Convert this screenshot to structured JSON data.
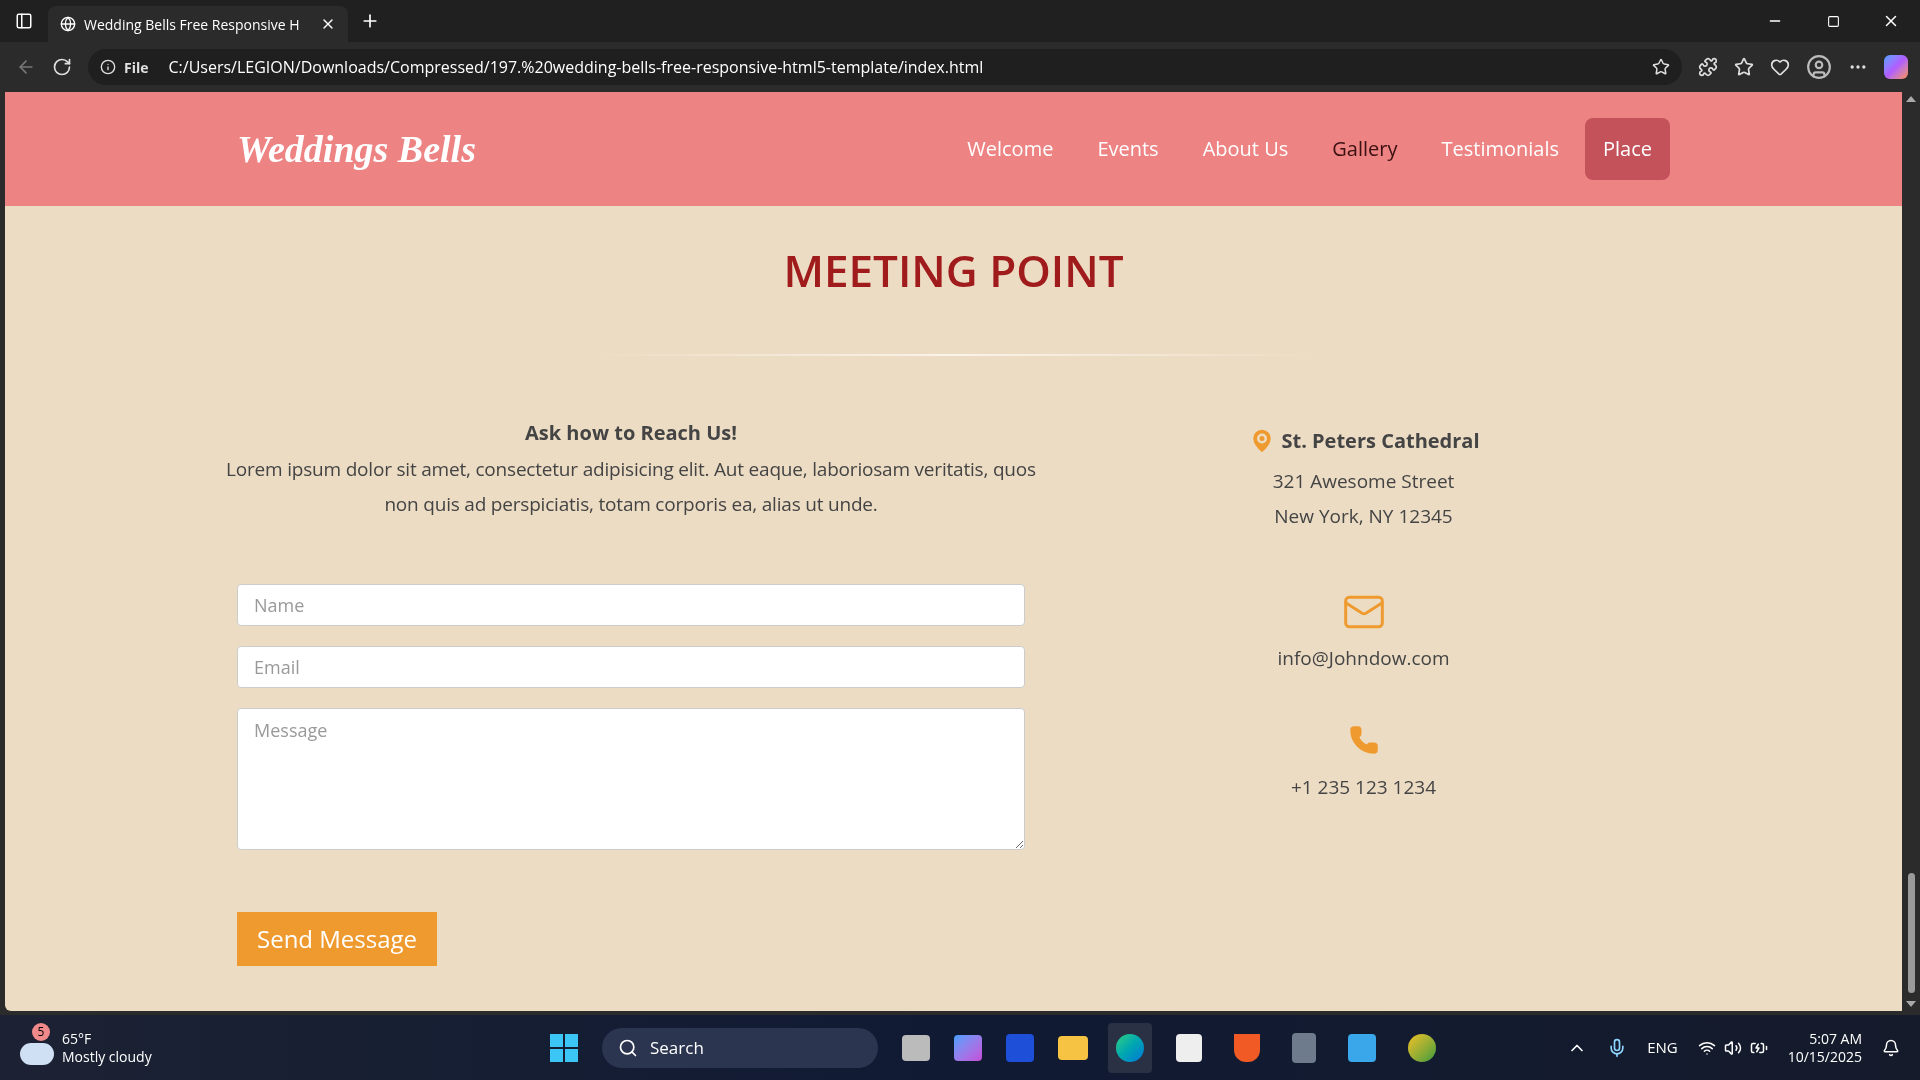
{
  "browser": {
    "tab_title": "Wedding Bells Free Responsive H",
    "url_label": "File",
    "url": "C:/Users/LEGION/Downloads/Compressed/197.%20wedding-bells-free-responsive-html5-template/index.html"
  },
  "header": {
    "logo": "Weddings Bells",
    "nav": [
      {
        "label": "Welcome",
        "selected": false,
        "hovered": false
      },
      {
        "label": "Events",
        "selected": false,
        "hovered": false
      },
      {
        "label": "About Us",
        "selected": false,
        "hovered": false
      },
      {
        "label": "Gallery",
        "selected": false,
        "hovered": true
      },
      {
        "label": "Testimonials",
        "selected": false,
        "hovered": false
      },
      {
        "label": "Place",
        "selected": true,
        "hovered": false
      }
    ]
  },
  "section": {
    "title": "MEETING POINT"
  },
  "contact": {
    "heading": "Ask how to Reach Us!",
    "text": "Lorem ipsum dolor sit amet, consectetur adipisicing elit. Aut eaque, laboriosam veritatis, quos non quis ad perspiciatis, totam corporis ea, alias ut unde.",
    "fields": [
      {
        "kind": "input",
        "placeholder": "Name"
      },
      {
        "kind": "input",
        "placeholder": "Email"
      },
      {
        "kind": "textarea",
        "placeholder": "Message"
      }
    ],
    "button": "Send Message"
  },
  "info": {
    "place": "St. Peters Cathedral",
    "address": [
      "321 Awesome Street",
      "New York, NY 12345"
    ],
    "email": "info@Johndow.com",
    "phone": "+1 235 123 1234"
  },
  "taskbar": {
    "weather_badge": "5",
    "temperature": "65°F",
    "condition": "Mostly cloudy",
    "search": "Search",
    "language": "ENG",
    "time": "5:07 AM",
    "date": "10/15/2025"
  }
}
